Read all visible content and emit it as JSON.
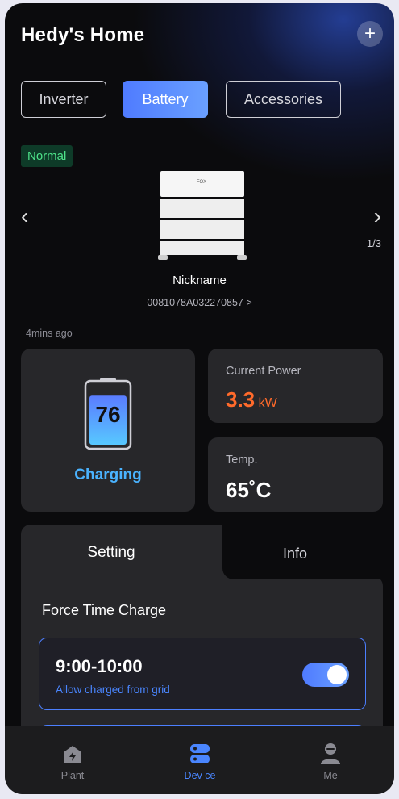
{
  "header": {
    "title": "Hedy's Home",
    "add_icon": "plus-icon"
  },
  "device_tabs": [
    {
      "label": "Inverter",
      "active": false
    },
    {
      "label": "Battery",
      "active": true
    },
    {
      "label": "Accessories",
      "active": false
    }
  ],
  "status_badge": "Normal",
  "device": {
    "brand_mark": "FOX",
    "nickname": "Nickname",
    "serial": "0081078A032270857",
    "serial_chevron": ">",
    "prev_arrow": "‹",
    "next_arrow": "›",
    "pager": "1/3"
  },
  "updated": "4mins ago",
  "battery": {
    "soc": 76,
    "soc_label": "76",
    "state": "Charging"
  },
  "power": {
    "label": "Current Power",
    "value": "3.3",
    "unit": "kW"
  },
  "temp": {
    "label": "Temp.",
    "value": "65˚C"
  },
  "content_tabs": [
    {
      "label": "Setting",
      "active": true
    },
    {
      "label": "Info",
      "active": false
    }
  ],
  "force_charge": {
    "title": "Force Time Charge",
    "slots": [
      {
        "time": "9:00-10:00",
        "subtitle": "Allow charged from grid",
        "enabled": true
      }
    ]
  },
  "bottom_nav": [
    {
      "label": "Plant",
      "icon": "house-lightning-icon",
      "active": false
    },
    {
      "label": "Dev ce",
      "icon": "device-icon",
      "active": true
    },
    {
      "label": "Me",
      "icon": "person-icon",
      "active": false
    }
  ],
  "colors": {
    "accent": "#4f7bff",
    "power": "#ff6a2b",
    "charging": "#4ab3ff",
    "normal_badge": "#4ee38a"
  }
}
